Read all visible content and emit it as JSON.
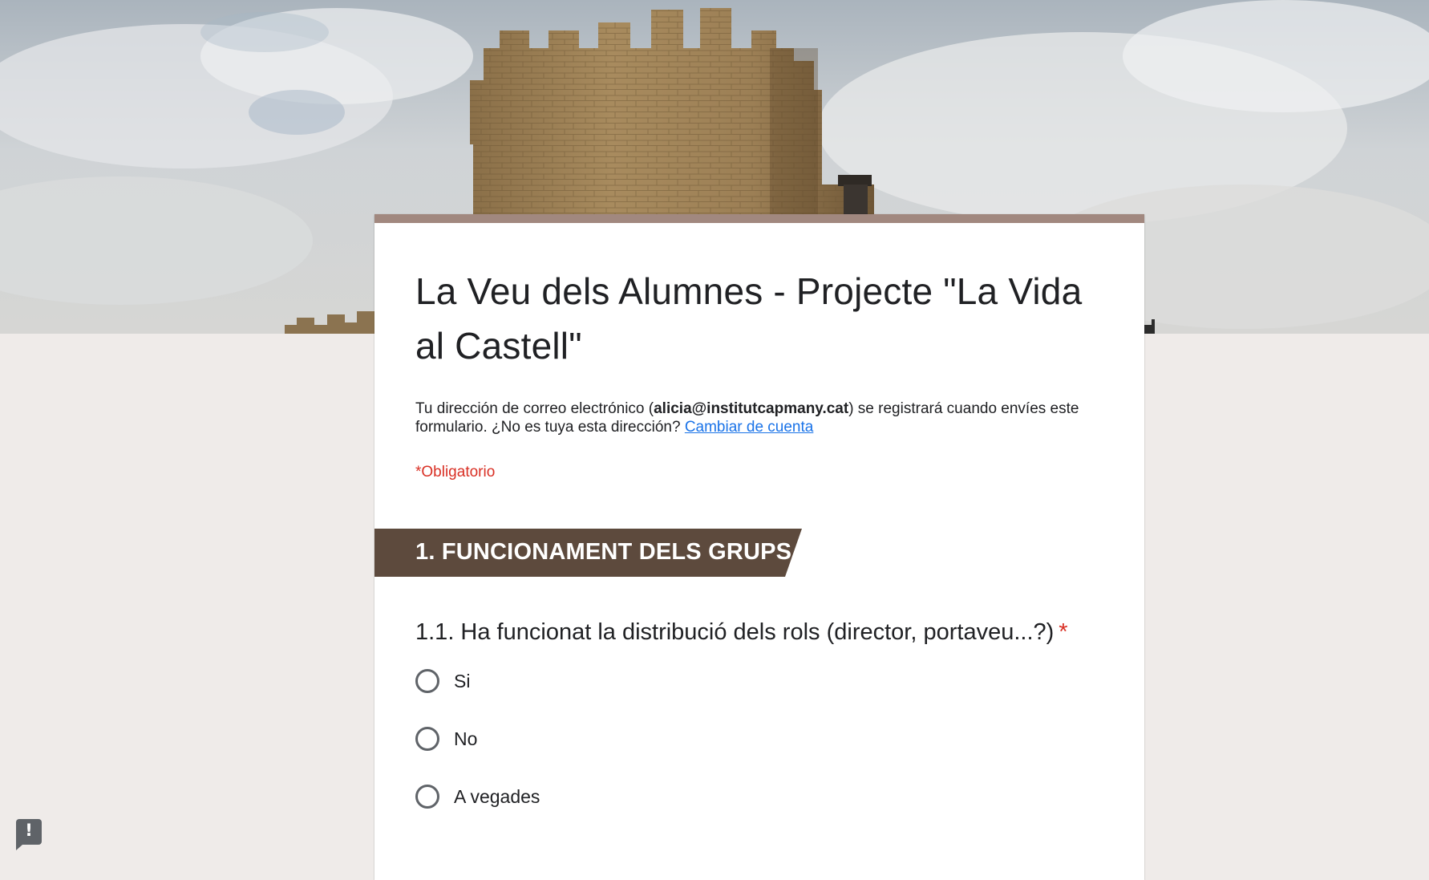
{
  "header_image": {
    "icon": "castle-tower-photo"
  },
  "colors": {
    "page_background": "#efebe9",
    "card_accent": "#a1887f",
    "section_header_bg": "#5d4a3d",
    "required": "#d93025",
    "link": "#1a73e8"
  },
  "form": {
    "title": "La Veu dels Alumnes - Projecte \"La Vida al Castell\"",
    "email_notice": {
      "prefix": "Tu dirección de correo electrónico (",
      "email": "alicia@institutcapmany.cat",
      "suffix": ") se registrará cuando envíes este formulario. ¿No es tuya esta dirección? ",
      "switch_account_link": "Cambiar de cuenta"
    },
    "required_note": "*Obligatorio"
  },
  "section": {
    "title": "1. FUNCIONAMENT DELS GRUPS"
  },
  "question": {
    "title": "1.1. Ha funcionat la distribució dels rols (director, portaveu...?)",
    "required_marker": "*",
    "options": [
      {
        "label": "Si",
        "selected": false
      },
      {
        "label": "No",
        "selected": false
      },
      {
        "label": "A vegades",
        "selected": false
      }
    ]
  },
  "feedback": {
    "icon": "feedback-exclamation-icon",
    "glyph": "!"
  }
}
